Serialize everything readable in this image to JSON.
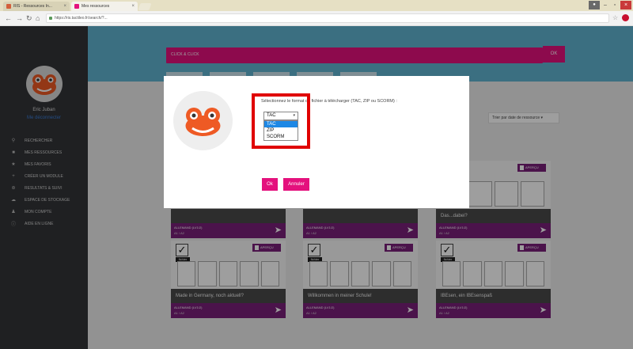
{
  "browser": {
    "tabs": [
      {
        "label": "RIS - Ressources In...",
        "active": false
      },
      {
        "label": "Mes ressources",
        "active": true
      }
    ],
    "url": "https://ris.tactileo.fr/search/?..."
  },
  "sidebar": {
    "user_name": "Eric Juban",
    "user_link": "Me déconnecter",
    "items": [
      {
        "icon": "search-icon",
        "label": "RECHERCHER"
      },
      {
        "icon": "resources-icon",
        "label": "MES RESSOURCES"
      },
      {
        "icon": "star-icon",
        "label": "MES FAVORIS"
      },
      {
        "icon": "plus-icon",
        "label": "CRÉER UN MODULE"
      },
      {
        "icon": "share-icon",
        "label": "RESULTATS & SUIVI"
      },
      {
        "icon": "cloud-icon",
        "label": "ESPACE DE STOCKAGE"
      },
      {
        "icon": "user-icon",
        "label": "MON COMPTE"
      },
      {
        "icon": "help-icon",
        "label": "AIDE EN LIGNE"
      }
    ]
  },
  "main": {
    "search_label": "CLICK & CLICK",
    "ok_label": "OK",
    "sort_label": "Trier par date de ressource",
    "preview_label": "APERÇU",
    "cards": [
      {
        "title": "",
        "lang": "ALLEMAND (LV1/2)",
        "level": "A1 / A2"
      },
      {
        "title": "",
        "lang": "ALLEMAND (LV1/2)",
        "level": "A1 / A2"
      },
      {
        "title": "Das...dabei?",
        "lang": "ALLEMAND (LV1/2)",
        "level": "A1 / A2"
      },
      {
        "title": "Made in Germany, noch aktuell?",
        "lang": "ALLEMAND (LV1/2)",
        "level": "A1 / A2",
        "check_label": "fichier"
      },
      {
        "title": "Willkommen in meiner Schule!",
        "lang": "ALLEMAND (LV1/2)",
        "level": "A1 / A2",
        "check_label": "fichier"
      },
      {
        "title": "IBEsen, ein IBEsenspaß",
        "lang": "ALLEMAND (LV1/2)",
        "level": "A1 / A2",
        "check_label": "fichier"
      }
    ]
  },
  "modal": {
    "prompt": "Sélectionnez le format du fichier à télécharger (TAC, ZIP ou SCORM) :",
    "selected": "TAC",
    "options": [
      "TAC",
      "ZIP",
      "SCORM"
    ],
    "ok_label": "Ok",
    "cancel_label": "Annuler"
  },
  "colors": {
    "accent": "#e4117d",
    "sidebar": "#333538",
    "banner": "#5fb3d0",
    "card_footer": "#7a1f7a",
    "highlight": "#e00000"
  }
}
